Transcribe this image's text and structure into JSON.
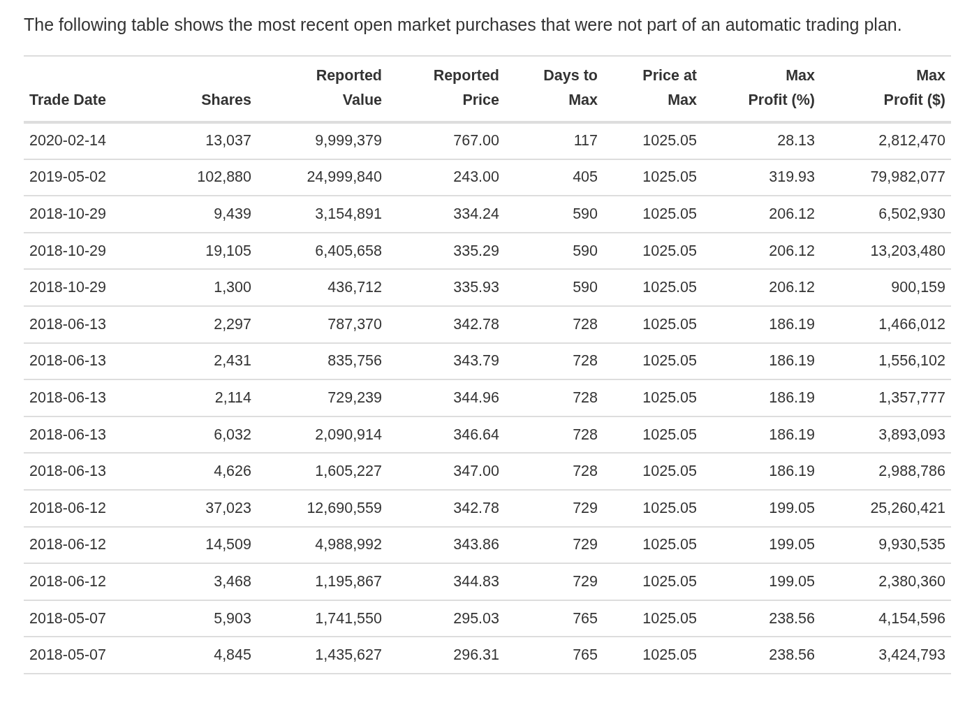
{
  "intro": "The following table shows the most recent open market purchases that were not part of an automatic trading plan.",
  "table": {
    "columns": [
      "Trade Date",
      "Shares",
      "Reported\nValue",
      "Reported\nPrice",
      "Days to\nMax",
      "Price at\nMax",
      "Max\nProfit (%)",
      "Max\nProfit ($)"
    ],
    "rows": [
      [
        "2020-02-14",
        "13,037",
        "9,999,379",
        "767.00",
        "117",
        "1025.05",
        "28.13",
        "2,812,470"
      ],
      [
        "2019-05-02",
        "102,880",
        "24,999,840",
        "243.00",
        "405",
        "1025.05",
        "319.93",
        "79,982,077"
      ],
      [
        "2018-10-29",
        "9,439",
        "3,154,891",
        "334.24",
        "590",
        "1025.05",
        "206.12",
        "6,502,930"
      ],
      [
        "2018-10-29",
        "19,105",
        "6,405,658",
        "335.29",
        "590",
        "1025.05",
        "206.12",
        "13,203,480"
      ],
      [
        "2018-10-29",
        "1,300",
        "436,712",
        "335.93",
        "590",
        "1025.05",
        "206.12",
        "900,159"
      ],
      [
        "2018-06-13",
        "2,297",
        "787,370",
        "342.78",
        "728",
        "1025.05",
        "186.19",
        "1,466,012"
      ],
      [
        "2018-06-13",
        "2,431",
        "835,756",
        "343.79",
        "728",
        "1025.05",
        "186.19",
        "1,556,102"
      ],
      [
        "2018-06-13",
        "2,114",
        "729,239",
        "344.96",
        "728",
        "1025.05",
        "186.19",
        "1,357,777"
      ],
      [
        "2018-06-13",
        "6,032",
        "2,090,914",
        "346.64",
        "728",
        "1025.05",
        "186.19",
        "3,893,093"
      ],
      [
        "2018-06-13",
        "4,626",
        "1,605,227",
        "347.00",
        "728",
        "1025.05",
        "186.19",
        "2,988,786"
      ],
      [
        "2018-06-12",
        "37,023",
        "12,690,559",
        "342.78",
        "729",
        "1025.05",
        "199.05",
        "25,260,421"
      ],
      [
        "2018-06-12",
        "14,509",
        "4,988,992",
        "343.86",
        "729",
        "1025.05",
        "199.05",
        "9,930,535"
      ],
      [
        "2018-06-12",
        "3,468",
        "1,195,867",
        "344.83",
        "729",
        "1025.05",
        "199.05",
        "2,380,360"
      ],
      [
        "2018-05-07",
        "5,903",
        "1,741,550",
        "295.03",
        "765",
        "1025.05",
        "238.56",
        "4,154,596"
      ],
      [
        "2018-05-07",
        "4,845",
        "1,435,627",
        "296.31",
        "765",
        "1025.05",
        "238.56",
        "3,424,793"
      ]
    ]
  }
}
